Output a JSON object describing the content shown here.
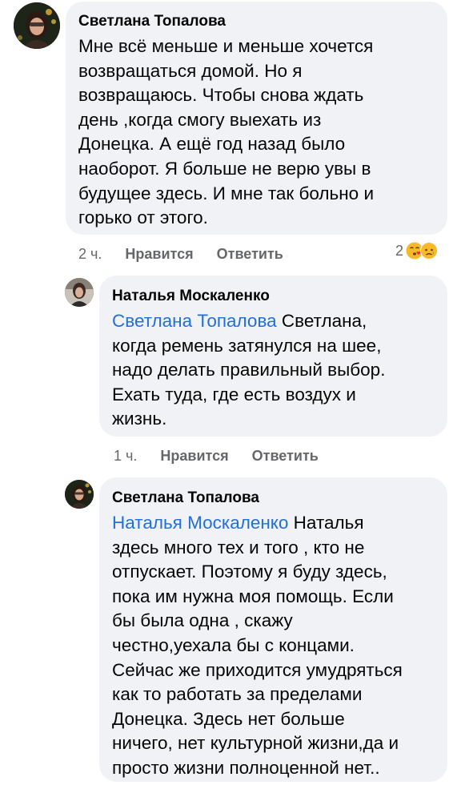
{
  "comments": [
    {
      "author": "Светлана Топалова",
      "mention": "",
      "text": "Мне всё меньше и меньше хочется\nвозвращаться домой. Но я\nвозвращаюсь. Чтобы снова ждать\nдень ,когда смогу выехать из\nДонецка. А ещё год назад было\nнаоборот. Я больше не верю увы в\nбудущее здесь. И мне так больно и\nгорько от этого.",
      "time": "2 ч.",
      "like_label": "Нравится",
      "reply_label": "Ответить",
      "reaction_count": "2",
      "reaction_icons": [
        "kiss-face-icon",
        "sad-face-icon"
      ]
    },
    {
      "author": "Наталья Москаленко",
      "mention": "Светлана Топалова",
      "text": " Светлана,\nкогда ремень затянулся на шее,\nнадо делать правильный выбор.\nЕхать туда, где есть воздух и\nжизнь.",
      "time": "1 ч.",
      "like_label": "Нравится",
      "reply_label": "Ответить"
    },
    {
      "author": "Светлана Топалова",
      "mention": "Наталья Москаленко",
      "text": " Наталья\nздесь много тех и того , кто не\nотпускает. Поэтому я буду здесь,\nпока им  нужна моя помощь. Если\nбы была одна , скажу\nчестно,уехала бы с концами.\nСейчас же приходится умудряться\nкак то работать за пределами\nДонецка. Здесь нет больше\nничего, нет культурной жизни,да и\nпросто жизни полноценной нет.."
    }
  ],
  "colors": {
    "bubble": "#f0f2f5",
    "mention": "#216fdb",
    "meta": "#65676b"
  }
}
